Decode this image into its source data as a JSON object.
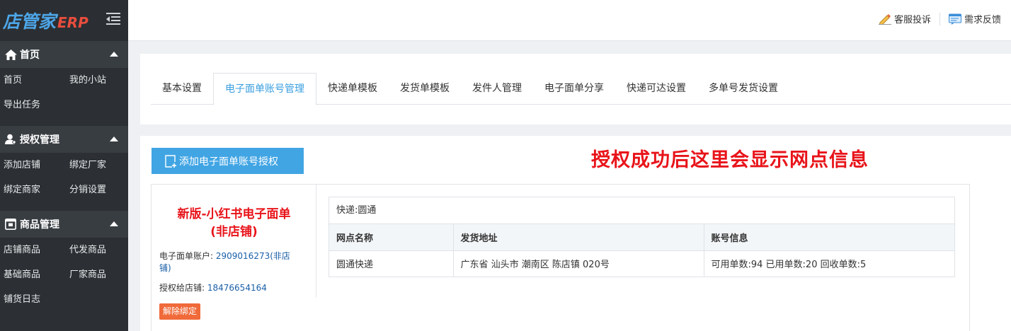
{
  "sidebar": {
    "logo_main": "店管家",
    "logo_suffix": "ERP",
    "sections": [
      {
        "title": "首页",
        "icon": "home-icon",
        "items": [
          "首页",
          "我的小站",
          "导出任务"
        ]
      },
      {
        "title": "授权管理",
        "icon": "user-icon",
        "items": [
          "添加店铺",
          "绑定厂家",
          "绑定商家",
          "分销设置"
        ]
      },
      {
        "title": "商品管理",
        "icon": "box-icon",
        "items": [
          "店铺商品",
          "代发商品",
          "基础商品",
          "厂家商品",
          "铺货日志"
        ]
      }
    ]
  },
  "topbar": {
    "actions": [
      {
        "label": "客服投诉",
        "icon": "pen-icon"
      },
      {
        "label": "需求反馈",
        "icon": "feedback-icon"
      }
    ]
  },
  "tabs": [
    {
      "label": "基本设置",
      "active": false
    },
    {
      "label": "电子面单账号管理",
      "active": true
    },
    {
      "label": "快递单模板",
      "active": false
    },
    {
      "label": "发货单模板",
      "active": false
    },
    {
      "label": "发件人管理",
      "active": false
    },
    {
      "label": "电子面单分享",
      "active": false
    },
    {
      "label": "快递可达设置",
      "active": false
    },
    {
      "label": "多单号发货设置",
      "active": false
    }
  ],
  "content": {
    "add_button": "添加电子面单账号授权",
    "notice": "授权成功后这里会显示网点信息",
    "card": {
      "title_line1": "新版-小红书电子面单",
      "title_line2": "(非店铺)",
      "account_label": "电子面单账户:",
      "account_value_1": "2909016273(非店",
      "account_value_2": "铺)",
      "auth_label": "授权给店铺:",
      "auth_value": "18476654164",
      "unbind_button": "解除绑定"
    },
    "table": {
      "caption": "快递:圆通",
      "headers": [
        "网点名称",
        "发货地址",
        "账号信息"
      ],
      "rows": [
        [
          "圆通快递",
          "广东省 汕头市 潮南区 陈店镇 020号",
          "可用单数:94 已用单数:20 回收单数:5"
        ]
      ]
    }
  },
  "colors": {
    "sidebar_bg": "#2c3034",
    "accent_blue": "#41a5e4",
    "notice_red": "#e8141a",
    "unbind_orange": "#f06a3a"
  }
}
